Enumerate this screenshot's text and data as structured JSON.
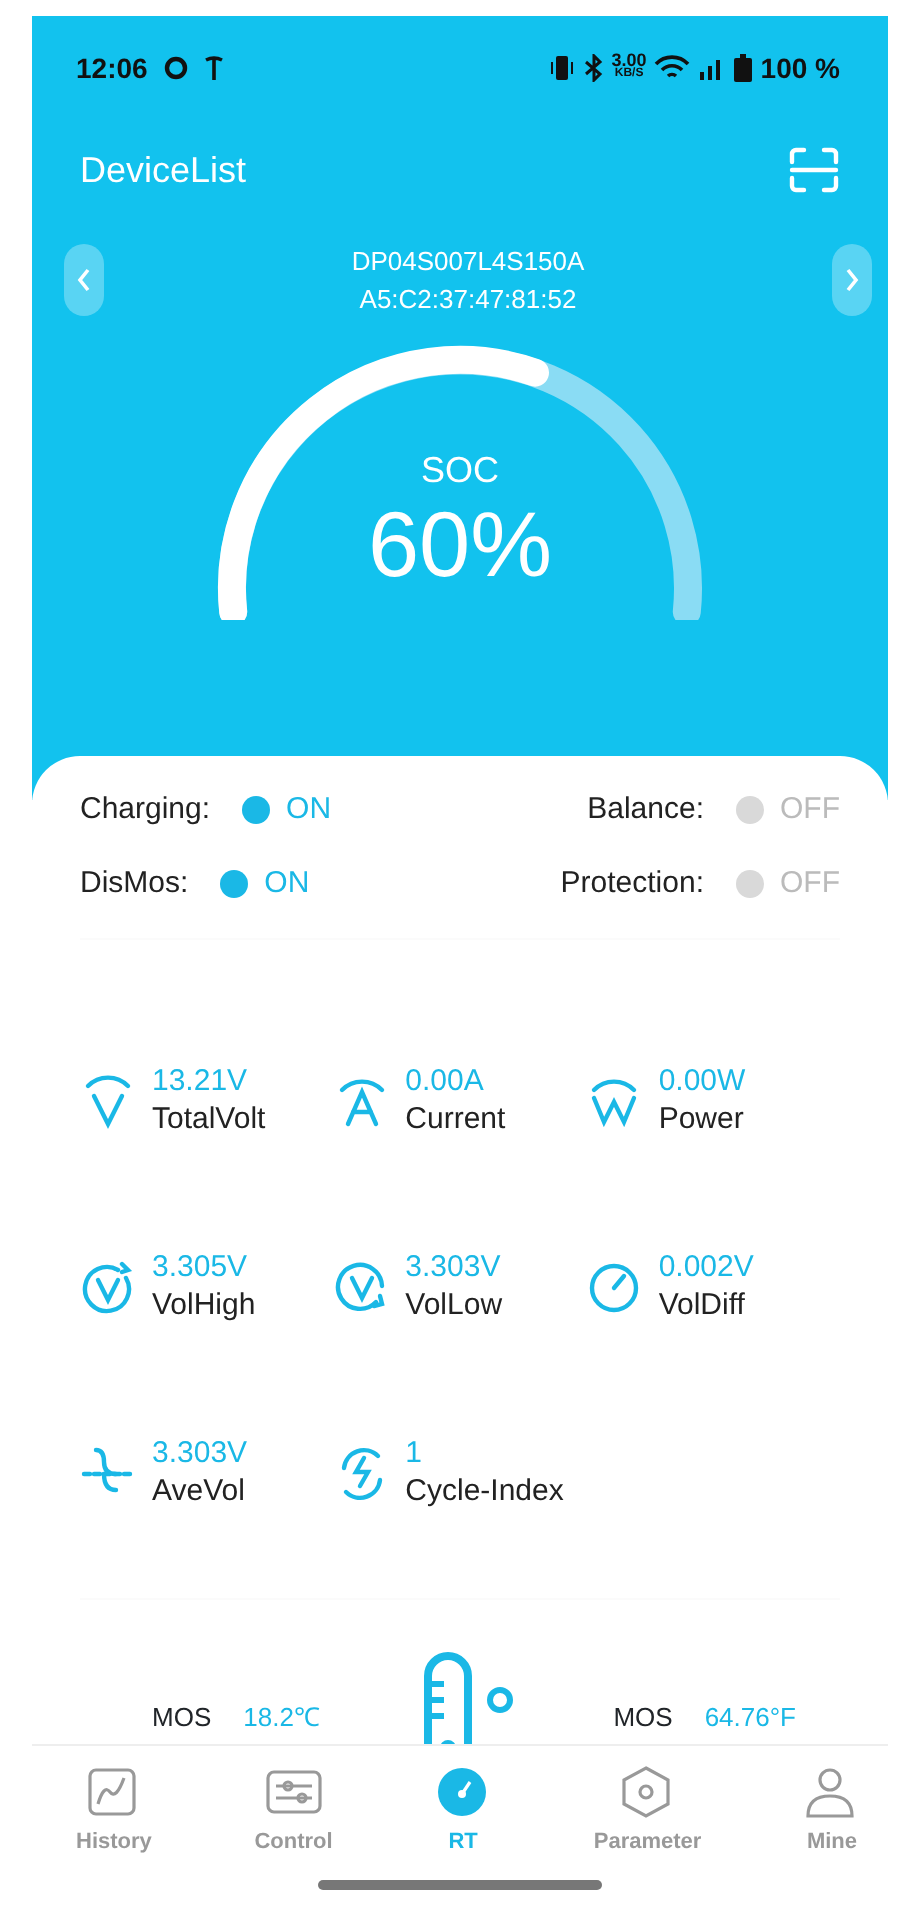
{
  "status_bar": {
    "time": "12:06",
    "net_speed": "3.00",
    "net_unit": "KB/S",
    "battery": "100 %"
  },
  "header": {
    "title": "DeviceList"
  },
  "device": {
    "name": "DP04S007L4S150A",
    "mac": "A5:C2:37:47:81:52"
  },
  "soc": {
    "label": "SOC",
    "reading": "60%"
  },
  "switches": [
    {
      "label": "Charging:",
      "state": "ON",
      "on": true
    },
    {
      "label": "Balance:",
      "state": "OFF",
      "on": false
    },
    {
      "label": "DisMos:",
      "state": "ON",
      "on": true
    },
    {
      "label": "Protection:",
      "state": "OFF",
      "on": false
    }
  ],
  "metrics": [
    {
      "value": "13.21V",
      "label": "TotalVolt"
    },
    {
      "value": "0.00A",
      "label": "Current"
    },
    {
      "value": "0.00W",
      "label": "Power"
    },
    {
      "value": "3.305V",
      "label": "VolHigh"
    },
    {
      "value": "3.303V",
      "label": "VolLow"
    },
    {
      "value": "0.002V",
      "label": "VolDiff"
    },
    {
      "value": "3.303V",
      "label": "AveVol"
    },
    {
      "value": "1",
      "label": "Cycle-Index"
    }
  ],
  "temperatures": [
    {
      "label": "MOS",
      "value": "18.2℃"
    },
    {
      "label": "MOS",
      "value": "64.76°F"
    }
  ],
  "tabs": [
    {
      "label": "History",
      "selected": false
    },
    {
      "label": "Control",
      "selected": false
    },
    {
      "label": "RT",
      "selected": true
    },
    {
      "label": "Parameter",
      "selected": false
    },
    {
      "label": "Mine",
      "selected": false
    }
  ]
}
